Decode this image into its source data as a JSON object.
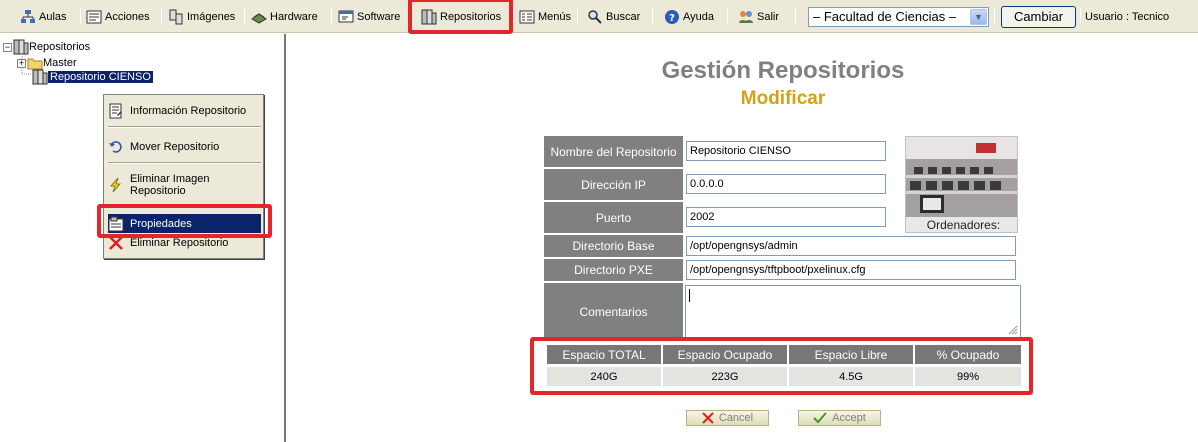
{
  "toolbar": {
    "items": [
      {
        "label": "Aulas",
        "icon": "network-icon"
      },
      {
        "label": "Acciones",
        "icon": "actions-icon"
      },
      {
        "label": "Imágenes",
        "icon": "images-icon"
      },
      {
        "label": "Hardware",
        "icon": "hardware-icon"
      },
      {
        "label": "Software",
        "icon": "software-icon"
      },
      {
        "label": "Repositorios",
        "icon": "repository-icon"
      },
      {
        "label": "Menús",
        "icon": "menu-icon"
      },
      {
        "label": "Buscar",
        "icon": "search-icon"
      },
      {
        "label": "Ayuda",
        "icon": "help-icon"
      },
      {
        "label": "Salir",
        "icon": "exit-icon"
      }
    ],
    "faculty_select": "– Facultad de Ciencias –",
    "change_button": "Cambiar",
    "user": "Usuario : Tecnico"
  },
  "tree": {
    "root": "Repositorios",
    "children": [
      "Master",
      "Repositorio CIENSO"
    ]
  },
  "context_menu": {
    "items": [
      "Información Repositorio",
      "Mover Repositorio",
      "Eliminar Imagen Repositorio",
      "Propiedades",
      "Eliminar Repositorio"
    ]
  },
  "main": {
    "title": "Gestión Repositorios",
    "subtitle": "Modificar",
    "fields": {
      "name_label": "Nombre del Repositorio",
      "name_value": "Repositorio CIENSO",
      "ip_label": "Dirección IP",
      "ip_value": "0.0.0.0",
      "port_label": "Puerto",
      "port_value": "2002",
      "basedir_label": "Directorio Base",
      "basedir_value": "/opt/opengnsys/admin",
      "pxedir_label": "Directorio PXE",
      "pxedir_value": "/opt/opengnsys/tftpboot/pxelinux.cfg",
      "comments_label": "Comentarios"
    },
    "photo_caption": "Ordenadores:",
    "space": {
      "headers": [
        "Espacio TOTAL",
        "Espacio Ocupado",
        "Espacio Libre",
        "% Ocupado"
      ],
      "values": [
        "240G",
        "223G",
        "4.5G",
        "99%"
      ]
    },
    "cancel_label": "Cancel",
    "accept_label": "Accept"
  },
  "colors": {
    "highlight": "#e4262b",
    "selection": "#0a246a",
    "title_gray": "#808080",
    "subtitle_gold": "#d4a017"
  }
}
